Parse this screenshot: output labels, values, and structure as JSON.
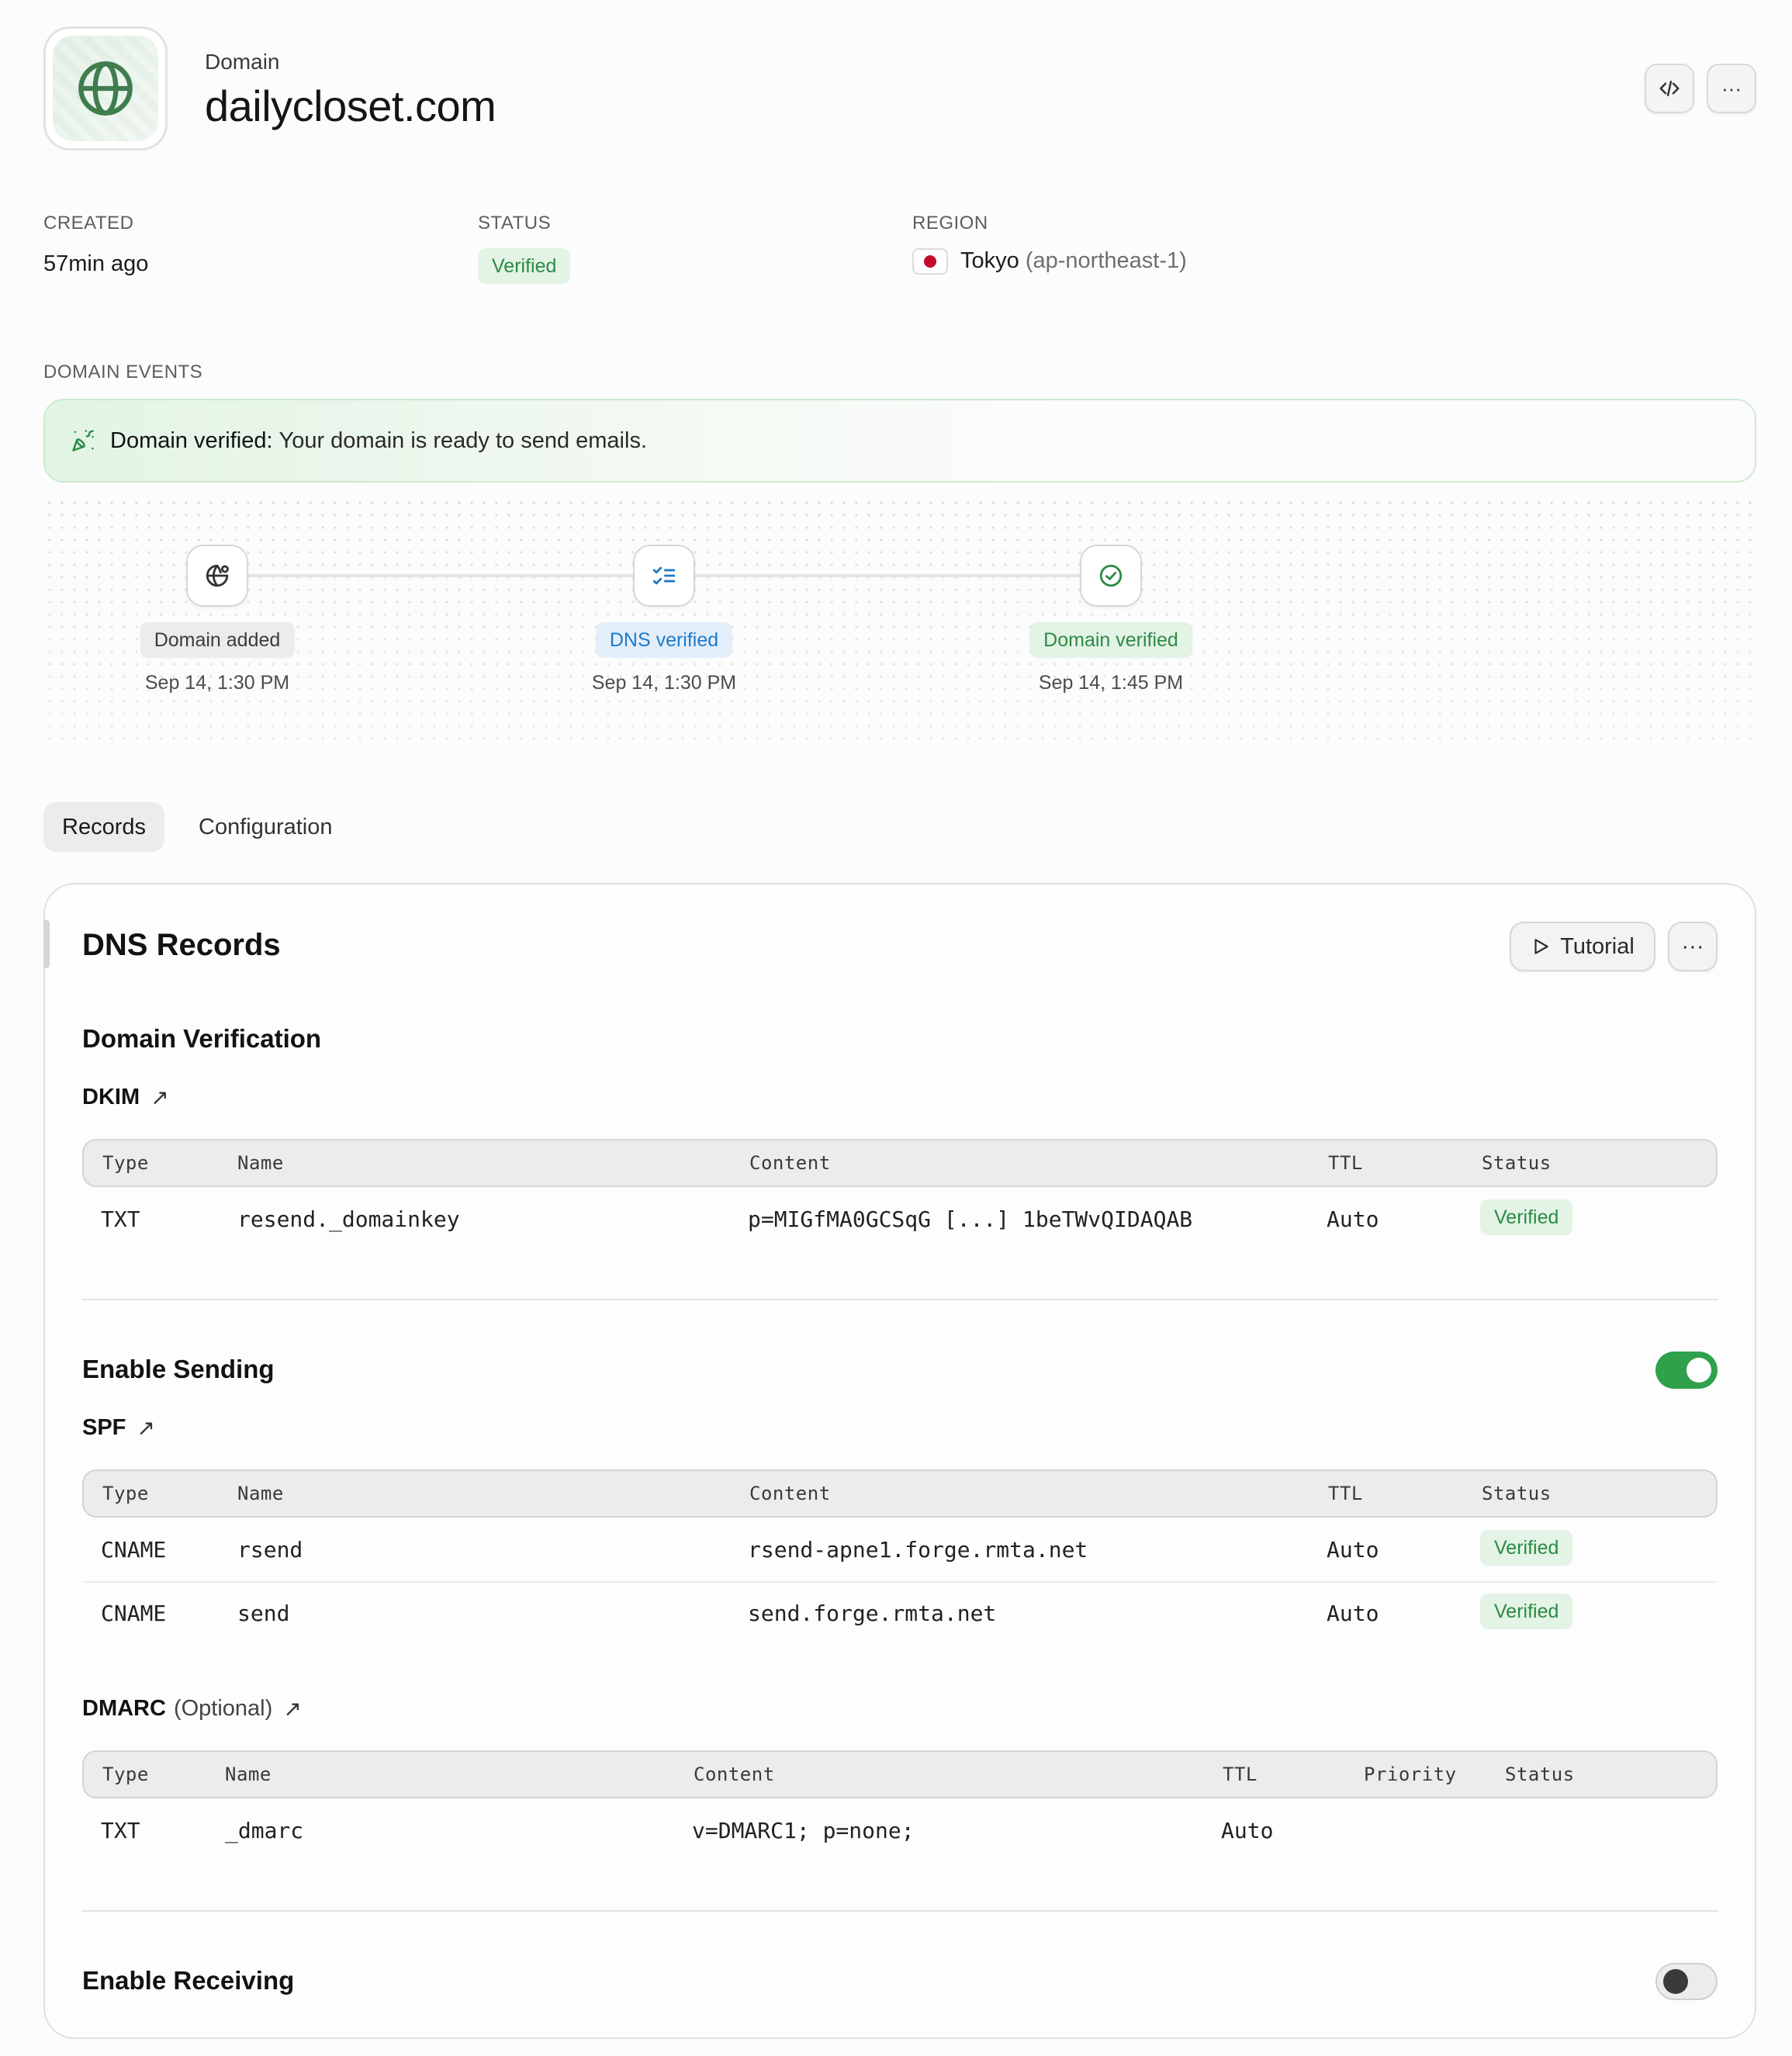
{
  "header": {
    "eyebrow": "Domain",
    "title": "dailycloset.com",
    "api_button_icon": "code-icon",
    "more_button_label": "···"
  },
  "meta": {
    "created": {
      "label": "CREATED",
      "value": "57min ago"
    },
    "status": {
      "label": "STATUS",
      "value": "Verified"
    },
    "region": {
      "label": "REGION",
      "city": "Tokyo",
      "code": "(ap-northeast-1)"
    }
  },
  "events": {
    "label": "DOMAIN EVENTS",
    "banner_title": "Domain verified:",
    "banner_text": "Your domain is ready to send emails.",
    "steps": [
      {
        "label": "Domain added",
        "date": "Sep 14, 1:30 PM",
        "icon": "globe-settings-icon"
      },
      {
        "label": "DNS verified",
        "date": "Sep 14, 1:30 PM",
        "icon": "checklist-icon"
      },
      {
        "label": "Domain verified",
        "date": "Sep 14, 1:45 PM",
        "icon": "check-circle-icon"
      }
    ]
  },
  "tabs": [
    {
      "label": "Records",
      "active": true
    },
    {
      "label": "Configuration",
      "active": false
    }
  ],
  "dns": {
    "title": "DNS Records",
    "tutorial_label": "Tutorial",
    "more_label": "···",
    "verification": {
      "heading": "Domain Verification",
      "dkim": {
        "label": "DKIM",
        "columns": [
          "Type",
          "Name",
          "Content",
          "TTL",
          "Status"
        ],
        "rows": [
          {
            "type": "TXT",
            "name": "resend._domainkey",
            "content": "p=MIGfMA0GCSqG [...] 1beTWvQIDAQAB",
            "ttl": "Auto",
            "status": "Verified"
          }
        ]
      }
    },
    "sending": {
      "heading": "Enable Sending",
      "enabled": true,
      "spf": {
        "label": "SPF",
        "columns": [
          "Type",
          "Name",
          "Content",
          "TTL",
          "Status"
        ],
        "rows": [
          {
            "type": "CNAME",
            "name": "rsend",
            "content": "rsend-apne1.forge.rmta.net",
            "ttl": "Auto",
            "status": "Verified"
          },
          {
            "type": "CNAME",
            "name": "send",
            "content": "send.forge.rmta.net",
            "ttl": "Auto",
            "status": "Verified"
          }
        ]
      },
      "dmarc": {
        "label": "DMARC",
        "optional": "(Optional)",
        "columns": [
          "Type",
          "Name",
          "Content",
          "TTL",
          "Priority",
          "Status"
        ],
        "rows": [
          {
            "type": "TXT",
            "name": "_dmarc",
            "content": "v=DMARC1; p=none;",
            "ttl": "Auto"
          }
        ]
      }
    },
    "receiving": {
      "heading": "Enable Receiving",
      "enabled": false
    }
  },
  "colors": {
    "accent_green": "#2fa14a",
    "verified_text": "#2c8a45",
    "verified_bg": "#e3f3e5",
    "dns_blue": "#1f7ac6",
    "flag_red": "#c40a2a"
  }
}
